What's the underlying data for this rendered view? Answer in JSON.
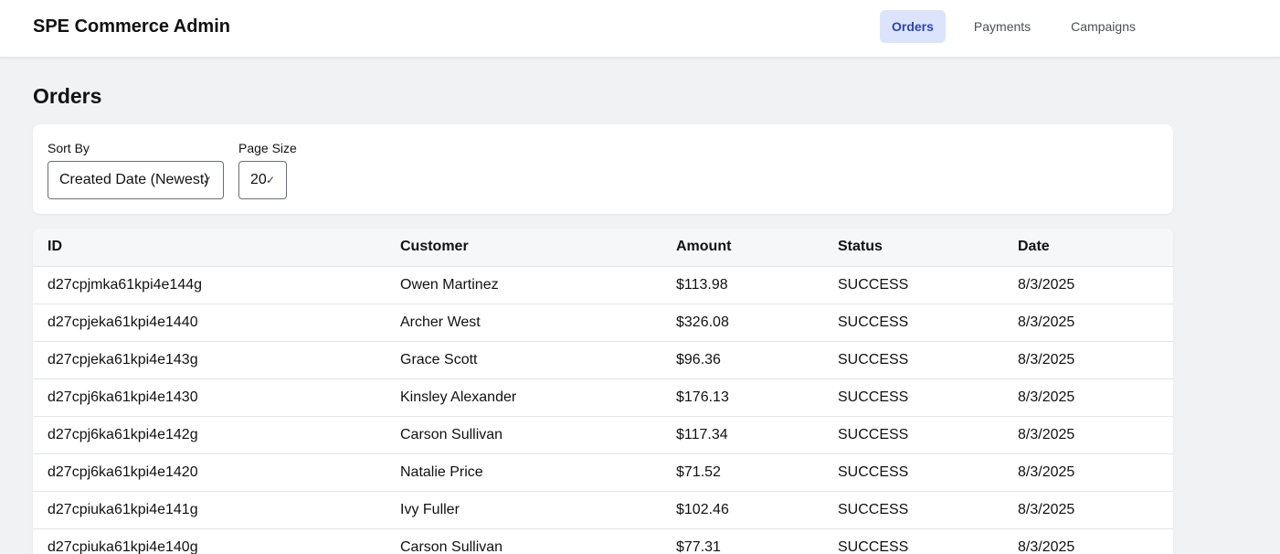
{
  "app": {
    "title": "SPE Commerce Admin"
  },
  "nav": [
    {
      "label": "Orders",
      "active": true
    },
    {
      "label": "Payments",
      "active": false
    },
    {
      "label": "Campaigns",
      "active": false
    }
  ],
  "page": {
    "title": "Orders"
  },
  "filters": {
    "sort_label": "Sort By",
    "sort_value": "Created Date (Newest)",
    "page_size_label": "Page Size",
    "page_size_value": "20"
  },
  "table": {
    "columns": [
      "ID",
      "Customer",
      "Amount",
      "Status",
      "Date"
    ],
    "rows": [
      [
        "d27cpjmka61kpi4e144g",
        "Owen Martinez",
        "$113.98",
        "SUCCESS",
        "8/3/2025"
      ],
      [
        "d27cpjeka61kpi4e1440",
        "Archer West",
        "$326.08",
        "SUCCESS",
        "8/3/2025"
      ],
      [
        "d27cpjeka61kpi4e143g",
        "Grace Scott",
        "$96.36",
        "SUCCESS",
        "8/3/2025"
      ],
      [
        "d27cpj6ka61kpi4e1430",
        "Kinsley Alexander",
        "$176.13",
        "SUCCESS",
        "8/3/2025"
      ],
      [
        "d27cpj6ka61kpi4e142g",
        "Carson Sullivan",
        "$117.34",
        "SUCCESS",
        "8/3/2025"
      ],
      [
        "d27cpj6ka61kpi4e1420",
        "Natalie Price",
        "$71.52",
        "SUCCESS",
        "8/3/2025"
      ],
      [
        "d27cpiuka61kpi4e141g",
        "Ivy Fuller",
        "$102.46",
        "SUCCESS",
        "8/3/2025"
      ],
      [
        "d27cpiuka61kpi4e140g",
        "Carson Sullivan",
        "$77.31",
        "SUCCESS",
        "8/3/2025"
      ]
    ]
  },
  "icons": {
    "select_chevron": "chevron-down-icon"
  },
  "colors": {
    "nav_active_bg": "#dbe4fa",
    "nav_active_text": "#2d46a6",
    "background": "#f1f2f4"
  }
}
